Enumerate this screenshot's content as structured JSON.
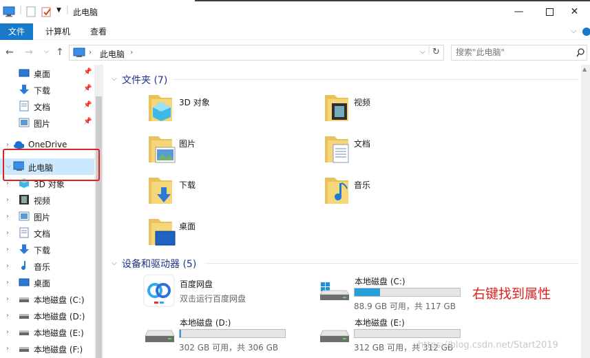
{
  "window": {
    "title": "此电脑"
  },
  "ribbon": {
    "tabs": [
      {
        "label": "文件",
        "active": true
      },
      {
        "label": "计算机",
        "active": false
      },
      {
        "label": "查看",
        "active": false
      }
    ]
  },
  "address": {
    "path": "此电脑"
  },
  "search": {
    "placeholder": "搜索\"此电脑\""
  },
  "sidebar": {
    "quick": [
      {
        "label": "桌面"
      },
      {
        "label": "下载"
      },
      {
        "label": "文档"
      },
      {
        "label": "图片"
      }
    ],
    "onedrive": "OneDrive",
    "thispc": "此电脑",
    "children": [
      {
        "label": "3D 对象"
      },
      {
        "label": "视频"
      },
      {
        "label": "图片"
      },
      {
        "label": "文档"
      },
      {
        "label": "下载"
      },
      {
        "label": "音乐"
      },
      {
        "label": "桌面"
      },
      {
        "label": "本地磁盘 (C:)"
      },
      {
        "label": "本地磁盘 (D:)"
      },
      {
        "label": "本地磁盘 (E:)"
      },
      {
        "label": "本地磁盘 (F:)"
      }
    ]
  },
  "folders": {
    "header": "文件夹 (7)",
    "items": [
      {
        "label": "3D 对象"
      },
      {
        "label": "视频"
      },
      {
        "label": "图片"
      },
      {
        "label": "文档"
      },
      {
        "label": "下载"
      },
      {
        "label": "音乐"
      },
      {
        "label": "桌面"
      }
    ]
  },
  "devices": {
    "header": "设备和驱动器 (5)",
    "baidu": {
      "label": "百度网盘",
      "sub": "双击运行百度网盘"
    },
    "drives": [
      {
        "label": "本地磁盘 (C:)",
        "info": "88.9 GB 可用，共 117 GB",
        "used_fraction": 0.24
      },
      {
        "label": "本地磁盘 (D:)",
        "info": "302 GB 可用，共 306 GB",
        "used_fraction": 0.013
      },
      {
        "label": "本地磁盘 (E:)",
        "info": "312 GB 可用，共 312 GB",
        "used_fraction": 0.0
      }
    ]
  },
  "annotation": "右键找到属性",
  "watermark": "https://blog.csdn.net/Start2019",
  "colors": {
    "accent": "#1979ca",
    "selected": "#cce8ff",
    "annotation": "#e02020",
    "bar_fill": "#26a0da"
  }
}
